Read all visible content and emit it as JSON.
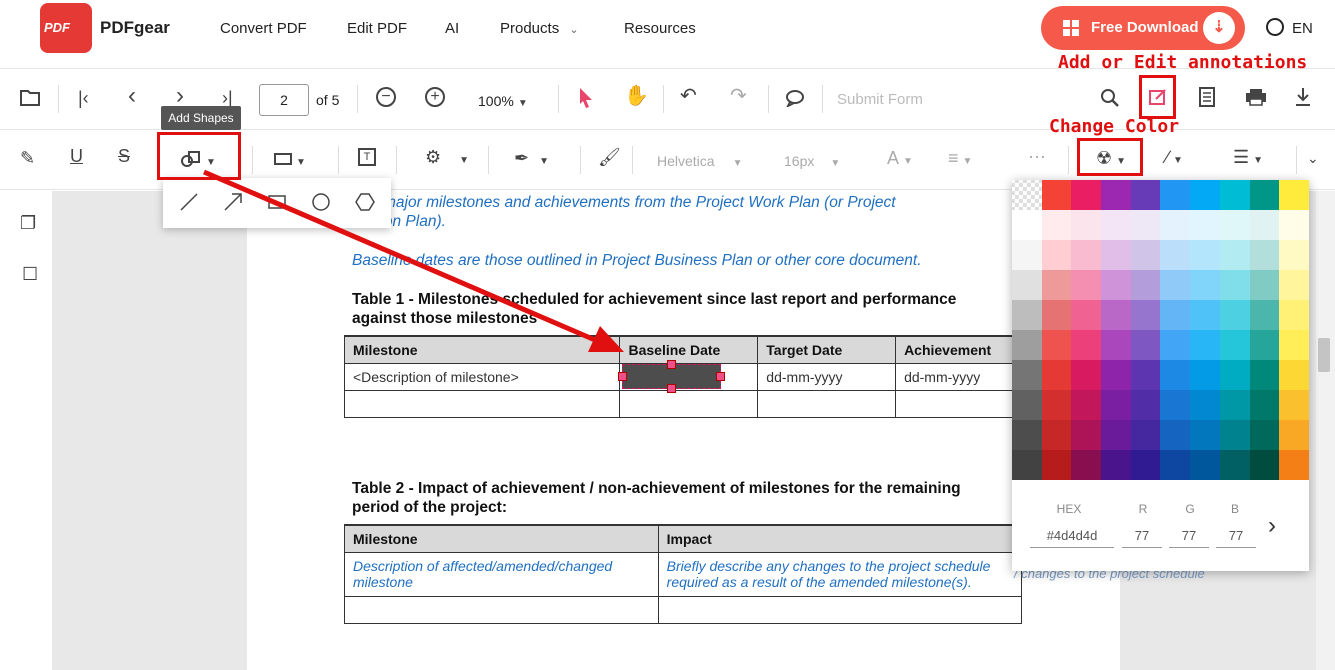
{
  "site": {
    "logo_text": "PDF",
    "brand": "PDFgear",
    "nav": [
      "Convert PDF",
      "Edit PDF",
      "AI",
      "Products",
      "Resources"
    ],
    "download": "Free Download",
    "lang": "EN"
  },
  "toolbar": {
    "page_current": "2",
    "page_total": "of 5",
    "zoom": "100%",
    "submit_form": "Submit Form",
    "font": "Helvetica",
    "font_size": "16px",
    "tooltip": "Add Shapes"
  },
  "annotations": {
    "add_edit": "Add or Edit annotations",
    "change_color": "Change Color"
  },
  "document": {
    "line1a": "…is major milestones and achievements from the Project Work Plan (or Project",
    "line1b": "…ution Plan).",
    "line2": "Baseline dates are those outlined in Project Business Plan or other core document.",
    "table1_title_a": "Table 1 - Milestones scheduled for achievement since last report and performance",
    "table1_title_b": "against those milestones",
    "table1_headers": [
      "Milestone",
      "Baseline Date",
      "Target Date",
      "Achievement"
    ],
    "table1_row1": [
      "<Description of milestone>",
      "",
      "dd-mm-yyyy",
      "dd-mm-yyyy"
    ],
    "table2_title_a": "Table 2 - Impact of achievement / non-achievement of milestones for the remaining",
    "table2_title_b": "period of the project:",
    "table2_headers": [
      "Milestone",
      "Impact"
    ],
    "table2_row1": [
      "Description of affected/amended/changed milestone",
      "Briefly describe any changes to the project schedule required as a result of the amended milestone(s)."
    ],
    "overflow_text": "/ changes to the project schedule"
  },
  "color_picker": {
    "hex_label": "HEX",
    "r_label": "R",
    "g_label": "G",
    "b_label": "B",
    "hex": "#4d4d4d",
    "r": "77",
    "g": "77",
    "b": "77",
    "swatches": [
      [
        "transparent",
        "#f44336",
        "#e91e63",
        "#9c27b0",
        "#673ab7",
        "#2196f3",
        "#03a9f4",
        "#00bcd4",
        "#009688",
        "#ffeb3b"
      ],
      [
        "#ffffff",
        "#ffebee",
        "#fce4ec",
        "#f3e5f5",
        "#ede7f6",
        "#e3f2fd",
        "#e1f5fe",
        "#e0f7fa",
        "#e0f2f1",
        "#fffde7"
      ],
      [
        "#f5f5f5",
        "#ffcdd2",
        "#f8bbd0",
        "#e1bee7",
        "#d1c4e9",
        "#bbdefb",
        "#b3e5fc",
        "#b2ebf2",
        "#b2dfdb",
        "#fff9c4"
      ],
      [
        "#e0e0e0",
        "#ef9a9a",
        "#f48fb1",
        "#ce93d8",
        "#b39ddb",
        "#90caf9",
        "#81d4fa",
        "#80deea",
        "#80cbc4",
        "#fff59d"
      ],
      [
        "#bdbdbd",
        "#e57373",
        "#f06292",
        "#ba68c8",
        "#9575cd",
        "#64b5f6",
        "#4fc3f7",
        "#4dd0e1",
        "#4db6ac",
        "#fff176"
      ],
      [
        "#9e9e9e",
        "#ef5350",
        "#ec407a",
        "#ab47bc",
        "#7e57c2",
        "#42a5f5",
        "#29b6f6",
        "#26c6da",
        "#26a69a",
        "#ffee58"
      ],
      [
        "#757575",
        "#e53935",
        "#d81b60",
        "#8e24aa",
        "#5e35b1",
        "#1e88e5",
        "#039be5",
        "#00acc1",
        "#00897b",
        "#fdd835"
      ],
      [
        "#616161",
        "#d32f2f",
        "#c2185b",
        "#7b1fa2",
        "#512da8",
        "#1976d2",
        "#0288d1",
        "#0097a7",
        "#00796b",
        "#fbc02d"
      ],
      [
        "#4d4d4d",
        "#c62828",
        "#ad1457",
        "#6a1b9a",
        "#4527a0",
        "#1565c0",
        "#0277bd",
        "#00838f",
        "#00695c",
        "#f9a825"
      ],
      [
        "#424242",
        "#b71c1c",
        "#880e4f",
        "#4a148c",
        "#311b92",
        "#0d47a1",
        "#01579b",
        "#006064",
        "#004d40",
        "#f57f17"
      ]
    ]
  }
}
